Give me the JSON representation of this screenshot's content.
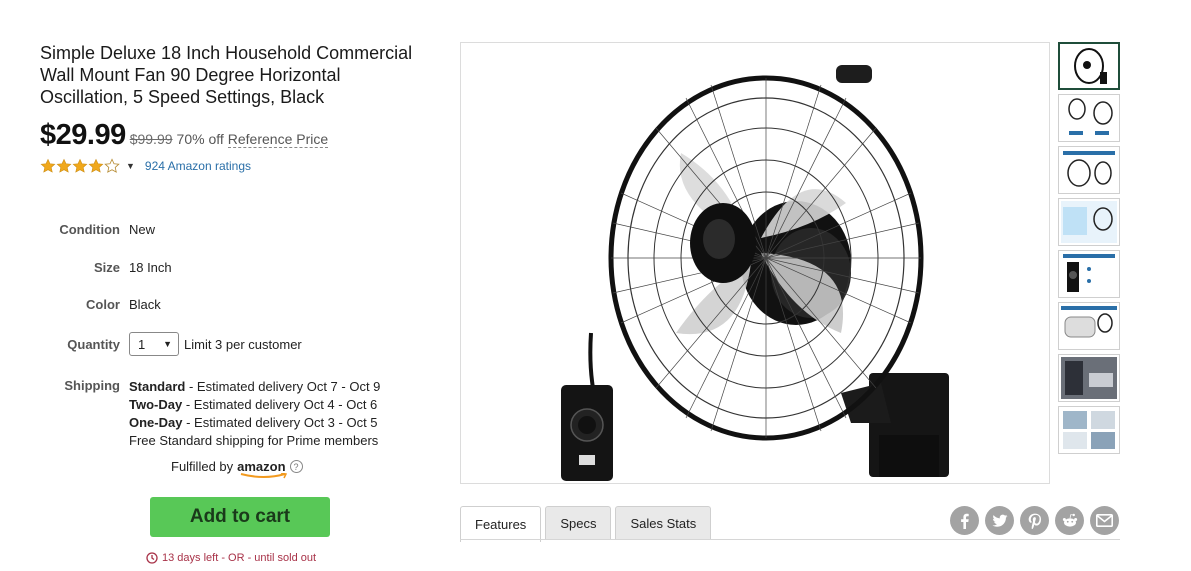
{
  "product": {
    "title": "Simple Deluxe 18 Inch Household Commercial Wall Mount Fan 90 Degree Horizontal Oscillation, 5 Speed Settings, Black",
    "price": "$29.99",
    "list_price": "$99.99",
    "discount": "70% off",
    "reference_label": "Reference Price",
    "rating_stars": 4,
    "ratings_text": "924 Amazon ratings"
  },
  "attributes": {
    "condition": {
      "label": "Condition",
      "value": "New"
    },
    "size": {
      "label": "Size",
      "value": "18 Inch"
    },
    "color": {
      "label": "Color",
      "value": "Black"
    }
  },
  "quantity": {
    "label": "Quantity",
    "selected": "1",
    "limit_text": "Limit 3 per customer"
  },
  "shipping": {
    "label": "Shipping",
    "options": [
      {
        "name": "Standard",
        "text": " - Estimated delivery Oct 7 - Oct 9"
      },
      {
        "name": "Two-Day",
        "text": " - Estimated delivery Oct 4 - Oct 6"
      },
      {
        "name": "One-Day",
        "text": " - Estimated delivery Oct 3 - Oct 5"
      }
    ],
    "free_note": "Free Standard shipping for Prime members"
  },
  "fulfilled": {
    "label": "Fulfilled by",
    "brand": "amazon",
    "help": "?"
  },
  "cart": {
    "label": "Add to cart"
  },
  "countdown": {
    "text": "13 days left - OR - until sold out"
  },
  "tabs": [
    {
      "label": "Features",
      "active": true
    },
    {
      "label": "Specs",
      "active": false
    },
    {
      "label": "Sales Stats",
      "active": false
    }
  ],
  "share_icons": [
    "facebook-icon",
    "twitter-icon",
    "pinterest-icon",
    "reddit-icon",
    "email-icon"
  ],
  "colors": {
    "cart_button": "#58c857",
    "countdown": "#a83248",
    "star": "#f0a81c",
    "link": "#2a6fa8",
    "share_icon": "#a3a3a3"
  }
}
